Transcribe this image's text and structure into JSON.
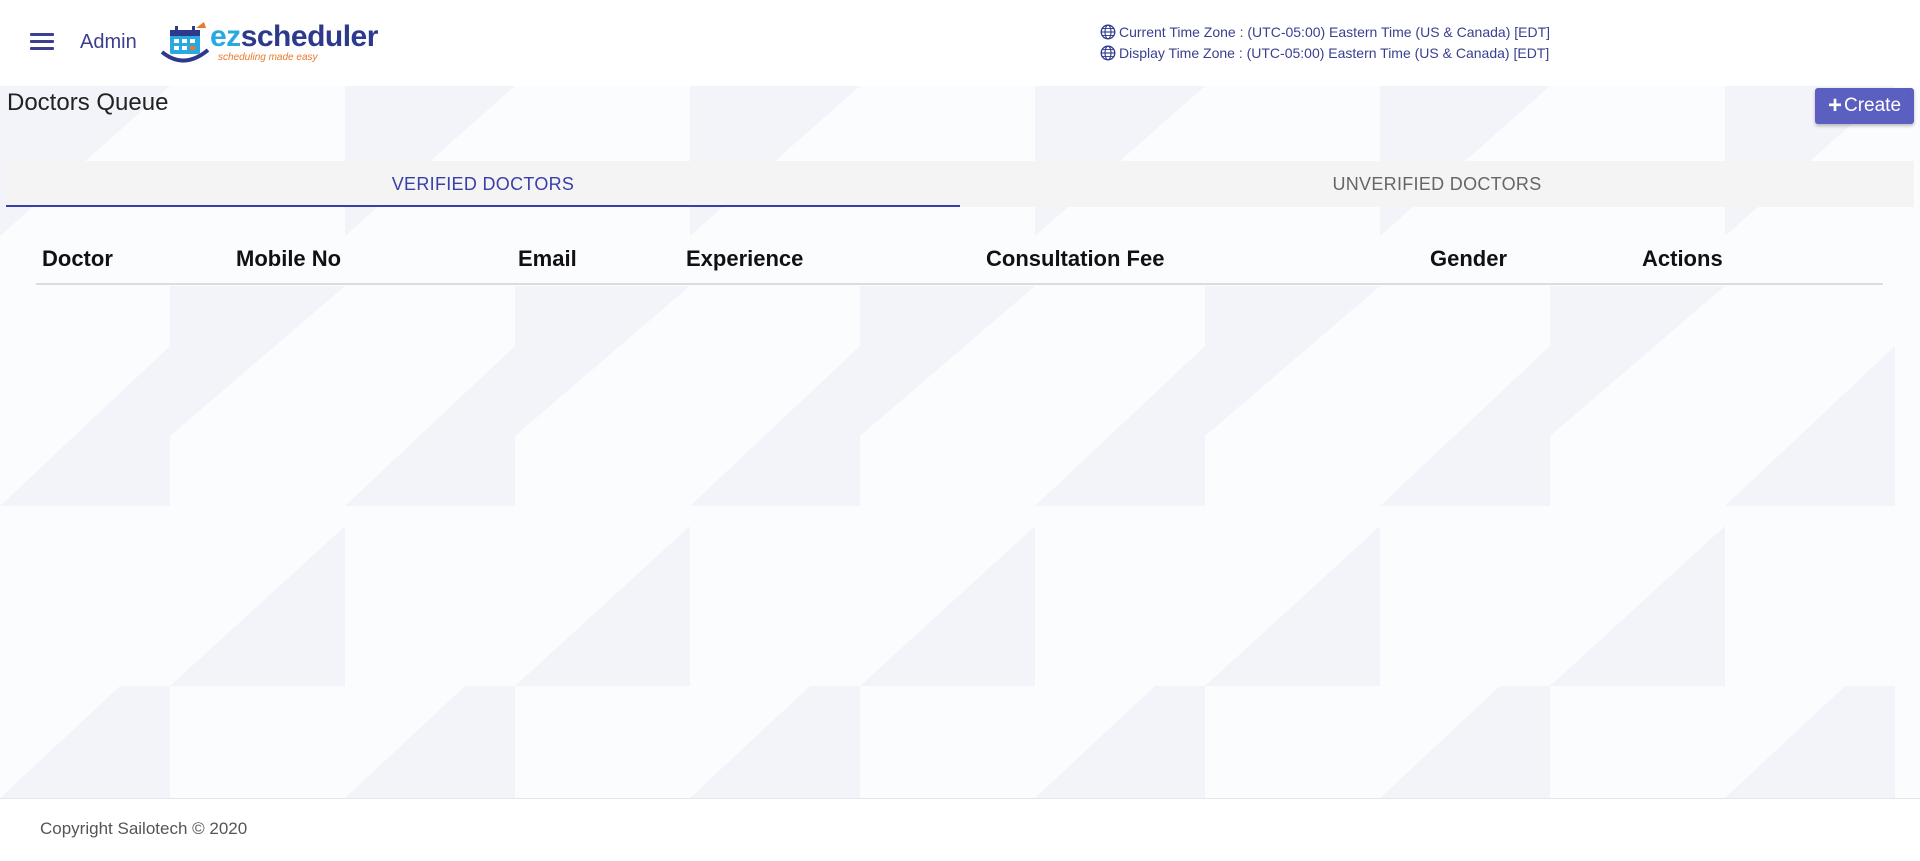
{
  "header": {
    "user_label": "Admin",
    "logo": {
      "brand_ez": "ez",
      "brand_rest": "scheduler",
      "tagline": "scheduling made easy"
    },
    "current_time_zone": "Current Time Zone : (UTC-05:00) Eastern Time (US & Canada) [EDT]",
    "display_time_zone": "Display Time Zone : (UTC-05:00) Eastern Time (US & Canada) [EDT]"
  },
  "page": {
    "title": "Doctors Queue",
    "create_label": "Create"
  },
  "tabs": [
    {
      "label": "VERIFIED DOCTORS",
      "active": true
    },
    {
      "label": "UNVERIFIED DOCTORS",
      "active": false
    }
  ],
  "table": {
    "columns": [
      "Doctor",
      "Mobile No",
      "Email",
      "Experience",
      "Consultation Fee",
      "Gender",
      "Actions"
    ],
    "rows": []
  },
  "footer": {
    "copyright": "Copyright Sailotech © 2020"
  },
  "colors": {
    "accent": "#3a3fa8",
    "button": "#5b60c0",
    "brand_blue": "#2d3a8c",
    "brand_cyan": "#2aa8e0",
    "brand_orange": "#e87a2a"
  }
}
